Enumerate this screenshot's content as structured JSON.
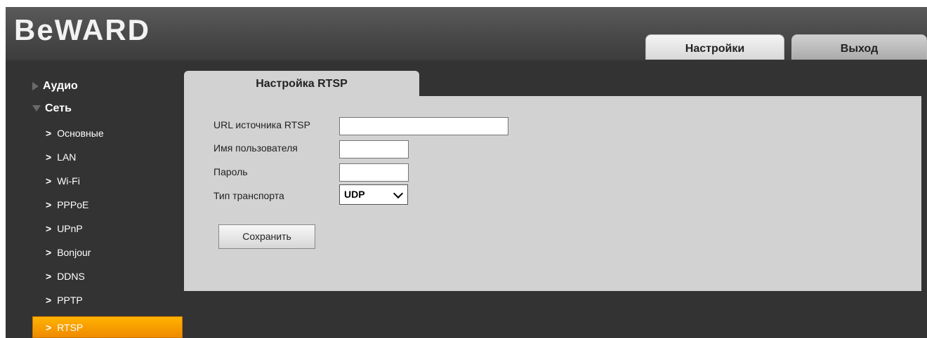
{
  "header": {
    "logo": "BeWARD",
    "tabs": [
      {
        "label": "Настройки"
      },
      {
        "label": "Выход"
      }
    ]
  },
  "sidebar": {
    "sections": [
      {
        "label": "Аудио",
        "expanded": false
      },
      {
        "label": "Сеть",
        "expanded": true
      }
    ],
    "items": [
      {
        "label": "Основные"
      },
      {
        "label": "LAN"
      },
      {
        "label": "Wi-Fi"
      },
      {
        "label": "PPPoE"
      },
      {
        "label": "UPnP"
      },
      {
        "label": "Bonjour"
      },
      {
        "label": "DDNS"
      },
      {
        "label": "PPTP"
      },
      {
        "label": "RTSP",
        "active": true
      }
    ]
  },
  "main": {
    "tab_title": "Настройка RTSP",
    "fields": {
      "url": {
        "label": "URL источника RTSP",
        "value": ""
      },
      "username": {
        "label": "Имя пользователя",
        "value": ""
      },
      "password": {
        "label": "Пароль",
        "value": ""
      },
      "transport": {
        "label": "Тип транспорта",
        "value": "UDP"
      }
    },
    "save_label": "Сохранить"
  },
  "colors": {
    "accent": "#f59a00",
    "background": "#333333",
    "panel": "#d2d2d2"
  }
}
